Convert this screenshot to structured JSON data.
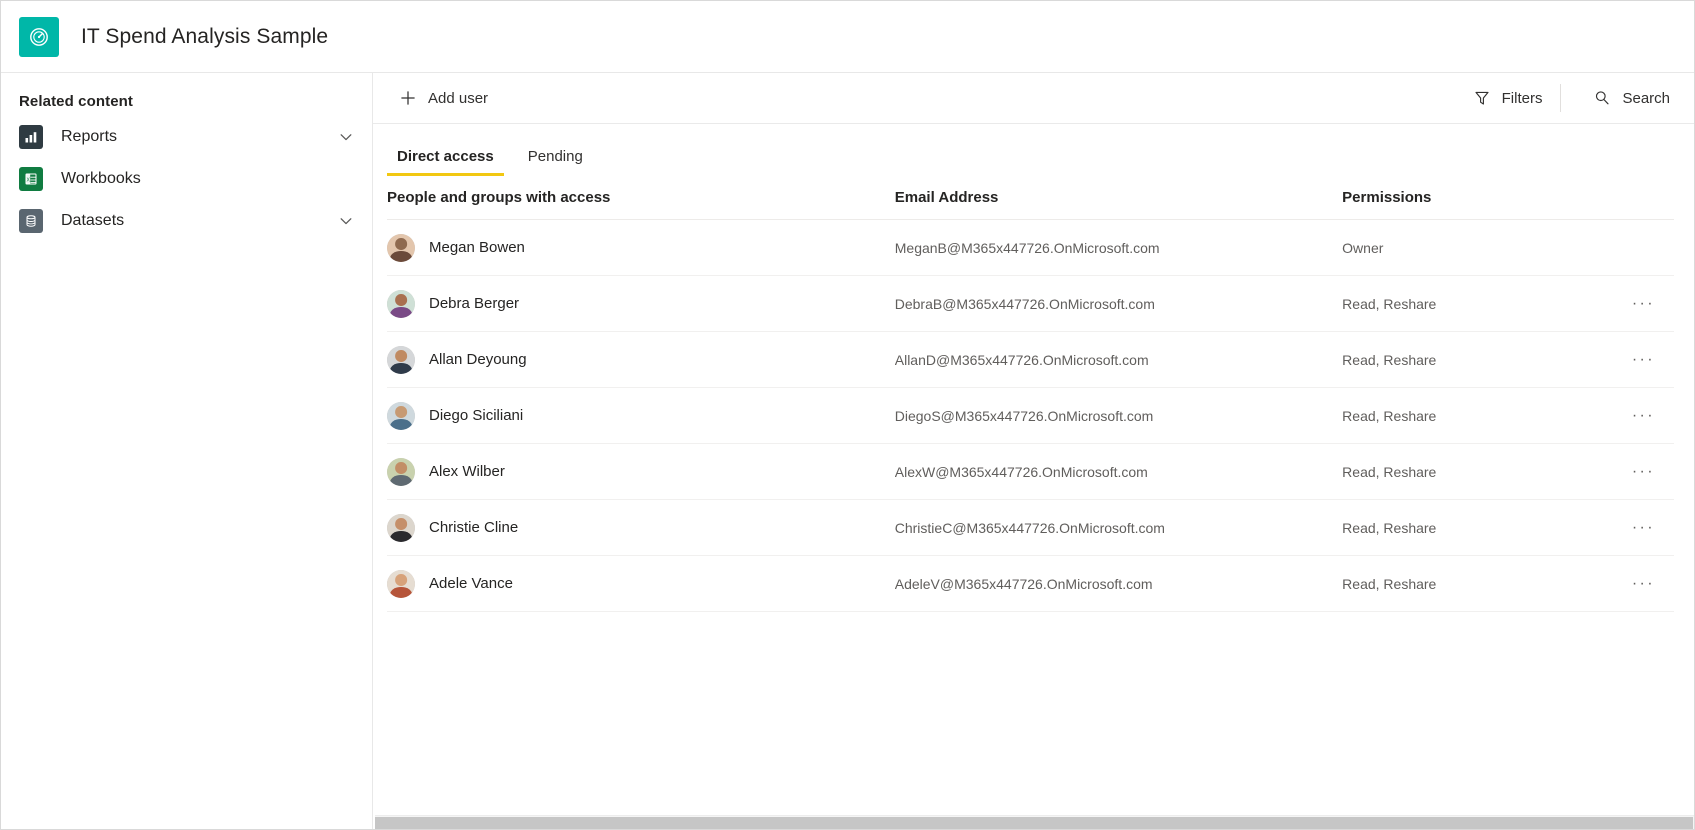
{
  "header": {
    "title": "IT Spend Analysis Sample",
    "icon": "gauge-icon",
    "icon_color": "#00B7A8"
  },
  "sidebar": {
    "title": "Related content",
    "items": [
      {
        "label": "Reports",
        "icon": "bar-chart-icon",
        "icon_color": "#2f3b42",
        "expandable": true
      },
      {
        "label": "Workbooks",
        "icon": "excel-workbook-icon",
        "icon_color": "#107c41",
        "expandable": false
      },
      {
        "label": "Datasets",
        "icon": "database-icon",
        "icon_color": "#5a6670",
        "expandable": true
      }
    ]
  },
  "commandbar": {
    "add_user_label": "Add user",
    "add_user_icon": "plus-icon",
    "filters_label": "Filters",
    "filters_icon": "funnel-icon",
    "search_label": "Search",
    "search_icon": "magnifier-icon"
  },
  "tabs": [
    {
      "label": "Direct access",
      "active": true
    },
    {
      "label": "Pending",
      "active": false
    }
  ],
  "tab_accent_color": "#F2C811",
  "table": {
    "columns": [
      "People and groups with access",
      "Email Address",
      "Permissions",
      ""
    ],
    "rows": [
      {
        "name": "Megan Bowen",
        "email": "MeganB@M365x447726.OnMicrosoft.com",
        "permission": "Owner",
        "menu": "",
        "avatar_skin": "#b07a55",
        "avatar_cloth": "#6b4a3a"
      },
      {
        "name": "Debra Berger",
        "email": "DebraB@M365x447726.OnMicrosoft.com",
        "permission": "Read, Reshare",
        "menu": "···",
        "avatar_skin": "#a97050",
        "avatar_cloth": "#7a4a86"
      },
      {
        "name": "Allan Deyoung",
        "email": "AllanD@M365x447726.OnMicrosoft.com",
        "permission": "Read, Reshare",
        "menu": "···",
        "avatar_skin": "#c08a62",
        "avatar_cloth": "#2f3b4a"
      },
      {
        "name": "Diego Siciliani",
        "email": "DiegoS@M365x447726.OnMicrosoft.com",
        "permission": "Read, Reshare",
        "menu": "···",
        "avatar_skin": "#c79a73",
        "avatar_cloth": "#4b6f8a"
      },
      {
        "name": "Alex Wilber",
        "email": "AlexW@M365x447726.OnMicrosoft.com",
        "permission": "Read, Reshare",
        "menu": "···",
        "avatar_skin": "#c28e66",
        "avatar_cloth": "#5f6a72"
      },
      {
        "name": "Christie Cline",
        "email": "ChristieC@M365x447726.OnMicrosoft.com",
        "permission": "Read, Reshare",
        "menu": "···",
        "avatar_skin": "#c58f6a",
        "avatar_cloth": "#2a2a2e"
      },
      {
        "name": "Adele Vance",
        "email": "AdeleV@M365x447726.OnMicrosoft.com",
        "permission": "Read, Reshare",
        "menu": "···",
        "avatar_skin": "#d7a27a",
        "avatar_cloth": "#b6553a"
      }
    ]
  }
}
